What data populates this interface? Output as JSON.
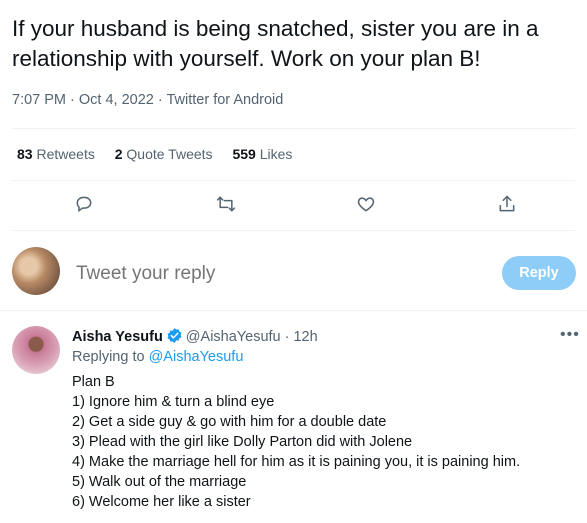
{
  "tweet": {
    "text": "If your husband is being snatched, sister you are in a relationship with yourself.  Work on your plan B!",
    "meta": "7:07 PM · Oct 4, 2022 · Twitter for Android",
    "retweets_count": "83",
    "retweets_label": "Retweets",
    "quotes_count": "2",
    "quotes_label": "Quote Tweets",
    "likes_count": "559",
    "likes_label": "Likes"
  },
  "actions": {
    "icons": [
      "reply-icon",
      "retweet-icon",
      "like-icon",
      "share-icon"
    ]
  },
  "composer": {
    "placeholder": "Tweet your reply",
    "button_label": "Reply"
  },
  "reply": {
    "name": "Aisha Yesufu",
    "handle_time": "@AishaYesufu · 12h",
    "replying_prefix": "Replying to",
    "replying_to": "@AishaYesufu",
    "lines": [
      "Plan B",
      "1) Ignore him & turn a blind eye",
      "2) Get a side guy & go with him for a double date",
      "3) Plead with the girl like Dolly Parton did with Jolene",
      "4) Make the marriage hell for him as it is paining you, it is paining him.",
      "5) Walk out of the marriage",
      "6) Welcome her like a sister"
    ]
  },
  "colors": {
    "accent": "#1d9bf0",
    "reply_button_disabled": "#8ecdf8",
    "secondary_text": "#536471"
  }
}
